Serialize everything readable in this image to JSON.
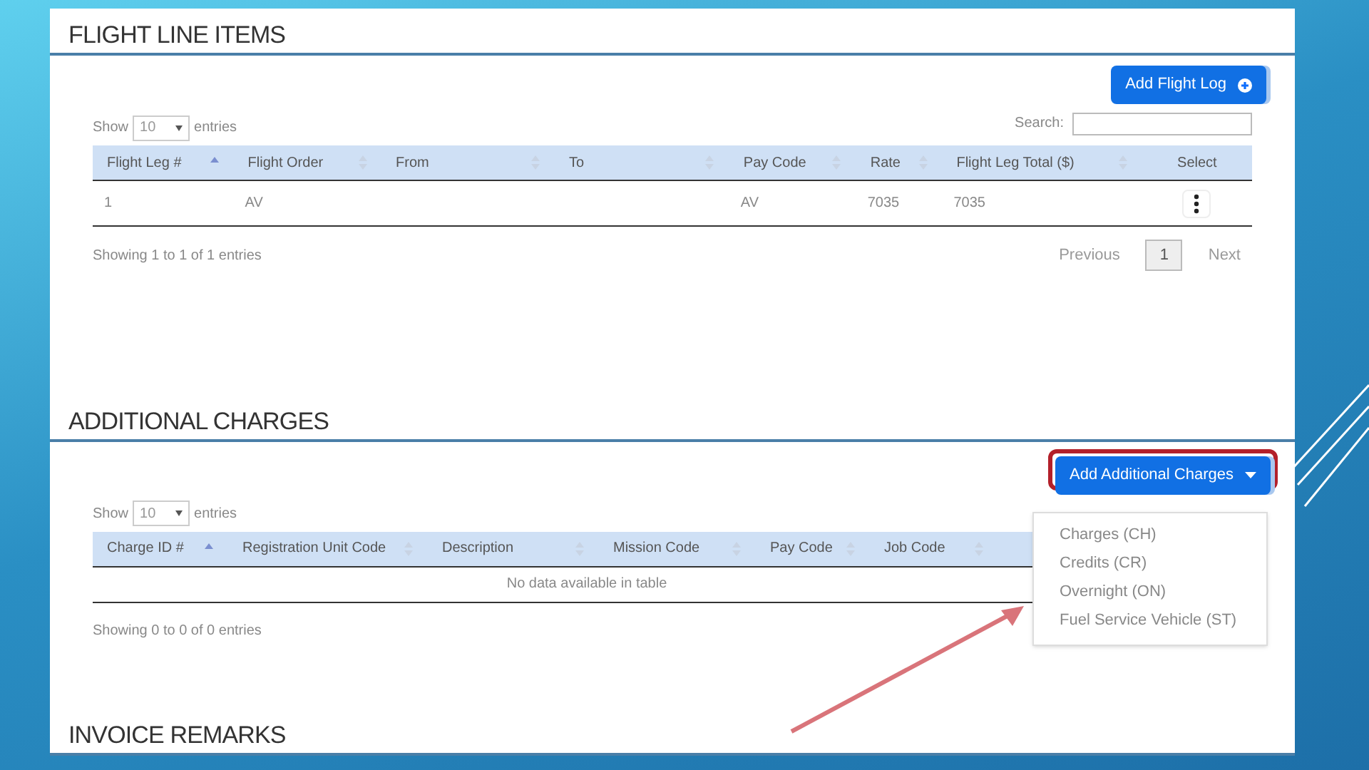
{
  "sections": [
    {
      "title": "FLIGHT LINE ITEMS",
      "button": {
        "label": "Add Flight Log",
        "kind": "add"
      },
      "length": {
        "before": "Show",
        "value": "10",
        "after": "entries"
      },
      "search": {
        "label": "Search:"
      },
      "columns": [
        {
          "label": "Flight Leg #",
          "sorted": true
        },
        {
          "label": "Flight Order",
          "sorted": false
        },
        {
          "label": "From",
          "sorted": false
        },
        {
          "label": "To",
          "sorted": false
        },
        {
          "label": "Pay Code",
          "sorted": false
        },
        {
          "label": "Rate",
          "sorted": false
        },
        {
          "label": "Flight Leg Total ($)",
          "sorted": false
        },
        {
          "label": "Select",
          "kind": "center"
        }
      ],
      "rows": [
        {
          "cells": [
            "1",
            "AV",
            "",
            "",
            "AV",
            "7035",
            "7035",
            ""
          ],
          "actions_menu": true
        }
      ],
      "info": "Showing 1 to 1 of 1 entries",
      "pagination": {
        "previous": "Previous",
        "pages": [
          {
            "label": "1",
            "selected": true
          }
        ],
        "next": "Next"
      }
    },
    {
      "title": "ADDITIONAL CHARGES",
      "button": {
        "label": "Add Additional Charges",
        "kind": "dropdown",
        "highlighted": true,
        "menu": [
          "Charges (CH)",
          "Credits (CR)",
          "Overnight (ON)",
          "Fuel Service Vehicle (ST)"
        ]
      },
      "length": {
        "before": "Show",
        "value": "10",
        "after": "entries"
      },
      "columns": [
        {
          "label": "Charge ID #",
          "sorted": true
        },
        {
          "label": "Registration Unit Code",
          "sorted": false
        },
        {
          "label": "Description",
          "sorted": false
        },
        {
          "label": "Mission Code",
          "sorted": false
        },
        {
          "label": "Pay Code",
          "sorted": false
        },
        {
          "label": "Job Code",
          "sorted": false
        }
      ],
      "empty_message": "No data available in table",
      "info": "Showing 0 to 0 of 0 entries"
    },
    {
      "title": "INVOICE REMARKS"
    }
  ]
}
